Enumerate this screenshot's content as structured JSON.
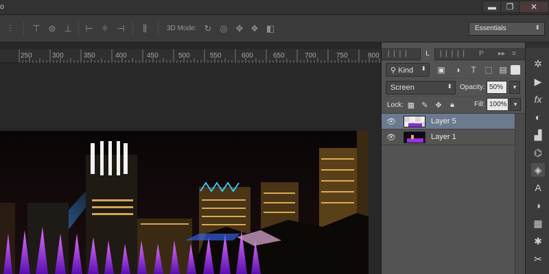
{
  "app": {
    "title_fragment": "o"
  },
  "window_controls": {
    "minimize": "▬",
    "restore": "❐",
    "close": "✕"
  },
  "options_bar": {
    "mode_3d_label": "3D Mode:",
    "workspace": "Essentials",
    "icons": [
      "distribute-icon",
      "align-top-icon",
      "align-vcenter-icon",
      "align-bottom-icon",
      "align-left-icon",
      "align-hcenter-icon",
      "align-right-icon",
      "auto-align-icon",
      "rotate-3d-icon",
      "roll-3d-icon",
      "drag-3d-icon",
      "slide-3d-icon",
      "scale-3d-icon"
    ]
  },
  "ruler": {
    "labels": [
      "250",
      "300",
      "350",
      "400",
      "450",
      "500",
      "550",
      "600",
      "650",
      "700",
      "750",
      "800"
    ]
  },
  "layers_panel": {
    "tabs_glyphs": [
      "L",
      "P"
    ],
    "active_tab": "L...",
    "filter": {
      "kind_label": "Kind",
      "icons": [
        "image-filter-icon",
        "adjustment-filter-icon",
        "type-filter-icon",
        "shape-filter-icon",
        "smart-filter-icon",
        "toggle-filter-icon"
      ]
    },
    "blend_mode": "Screen",
    "opacity_label": "Opacity:",
    "opacity_value": "50%",
    "lock_label": "Lock:",
    "fill_label": "Fill:",
    "fill_value": "100%",
    "layers": [
      {
        "name": "Layer 5",
        "visible": true,
        "selected": true
      },
      {
        "name": "Layer 1",
        "visible": true,
        "selected": false
      }
    ]
  },
  "dock": {
    "icons": [
      "history-icon",
      "actions-icon",
      "fx-styles-icon",
      "color-icon",
      "histogram-icon",
      "paths-icon",
      "layers-icon",
      "character-icon",
      "adjustments-icon",
      "swatches-icon",
      "brush-icon",
      "tools-presets-icon"
    ]
  },
  "colors": {
    "accent_selected": "#6b7a8e",
    "panel": "#535353",
    "chrome": "#3b3b3b"
  }
}
